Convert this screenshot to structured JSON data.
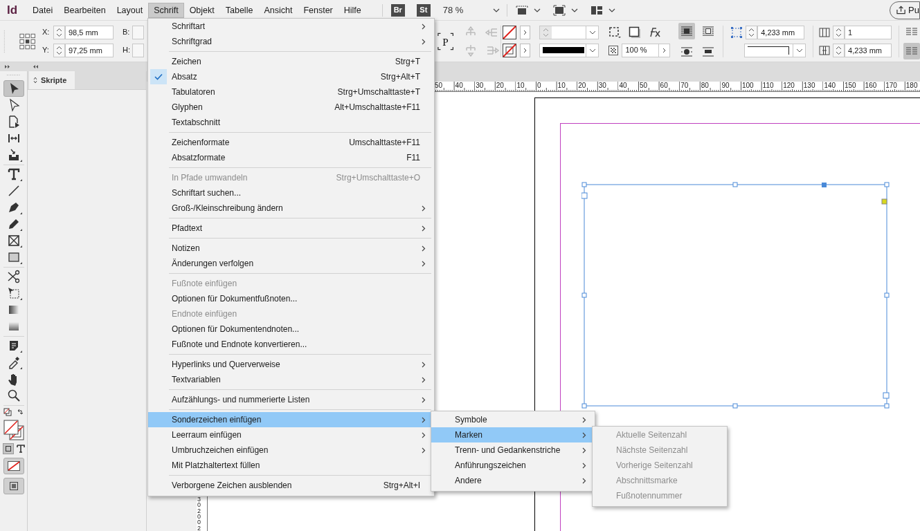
{
  "app_logo": "Id",
  "menu_bar": [
    {
      "label": "Datei",
      "selected": false
    },
    {
      "label": "Bearbeiten",
      "selected": false
    },
    {
      "label": "Layout",
      "selected": false
    },
    {
      "label": "Schrift",
      "selected": true
    },
    {
      "label": "Objekt",
      "selected": false
    },
    {
      "label": "Tabelle",
      "selected": false
    },
    {
      "label": "Ansicht",
      "selected": false
    },
    {
      "label": "Fenster",
      "selected": false
    },
    {
      "label": "Hilfe",
      "selected": false
    }
  ],
  "app_bar": {
    "badges": [
      "Br",
      "St"
    ],
    "zoom": "78 %",
    "share_button": "Pu"
  },
  "control_bar": {
    "x_label": "X:",
    "x_value": "98,5 mm",
    "y_label": "Y:",
    "y_value": "97,25 mm",
    "w_label": "B:",
    "h_label": "H:",
    "paragraph_glyph": "P",
    "opacity": "100 %",
    "frame_inset": "4,233 mm",
    "columns": "1",
    "gutter": "4,233 mm"
  },
  "panel": {
    "tab": "Skripte"
  },
  "tools": [
    {
      "kind": "selection",
      "selected": true,
      "flyout": false
    },
    {
      "kind": "direct",
      "selected": false,
      "flyout": false
    },
    {
      "kind": "page",
      "selected": false,
      "flyout": false
    },
    {
      "kind": "gap",
      "selected": false,
      "flyout": false
    },
    {
      "kind": "collector",
      "selected": false,
      "flyout": true
    },
    {
      "kind": "separator"
    },
    {
      "kind": "type",
      "selected": false,
      "flyout": true
    },
    {
      "kind": "line",
      "selected": false,
      "flyout": false
    },
    {
      "kind": "pen",
      "selected": false,
      "flyout": true
    },
    {
      "kind": "pencil",
      "selected": false,
      "flyout": true
    },
    {
      "kind": "frame",
      "selected": false,
      "flyout": true
    },
    {
      "kind": "rectangle",
      "selected": false,
      "flyout": true
    },
    {
      "kind": "separator"
    },
    {
      "kind": "scissors",
      "selected": false,
      "flyout": false
    },
    {
      "kind": "transform",
      "selected": false,
      "flyout": true
    },
    {
      "kind": "gradient",
      "selected": false,
      "flyout": false
    },
    {
      "kind": "feather",
      "selected": false,
      "flyout": false
    },
    {
      "kind": "separator"
    },
    {
      "kind": "note",
      "selected": false,
      "flyout": true
    },
    {
      "kind": "eyedropper",
      "selected": false,
      "flyout": true
    },
    {
      "kind": "hand",
      "selected": false,
      "flyout": false
    },
    {
      "kind": "zoom",
      "selected": false,
      "flyout": false
    },
    {
      "kind": "separator"
    }
  ],
  "ruler": {
    "horizontal": [
      "50",
      "40",
      "30",
      "20",
      "10",
      "0",
      "10",
      "20",
      "30",
      "40",
      "50",
      "60",
      "70",
      "80",
      "90",
      "100",
      "110",
      "120",
      "130",
      "140",
      "150",
      "160",
      "170",
      "180"
    ],
    "vertical": [
      "30",
      "200",
      "2"
    ]
  },
  "menu": {
    "items": [
      {
        "kind": "item",
        "label": "Schriftart",
        "submenu": true,
        "checked": false,
        "disabled": false,
        "selected": false
      },
      {
        "kind": "item",
        "label": "Schriftgrad",
        "submenu": true,
        "checked": false,
        "disabled": false,
        "selected": false
      },
      {
        "kind": "separator"
      },
      {
        "kind": "item",
        "label": "Zeichen",
        "shortcut": "Strg+T",
        "submenu": false,
        "checked": false,
        "disabled": false,
        "selected": false
      },
      {
        "kind": "item",
        "label": "Absatz",
        "shortcut": "Strg+Alt+T",
        "submenu": false,
        "checked": true,
        "disabled": false,
        "selected": false
      },
      {
        "kind": "item",
        "label": "Tabulatoren",
        "shortcut": "Strg+Umschalttaste+T",
        "submenu": false,
        "checked": false,
        "disabled": false,
        "selected": false
      },
      {
        "kind": "item",
        "label": "Glyphen",
        "shortcut": "Alt+Umschalttaste+F11",
        "submenu": false,
        "checked": false,
        "disabled": false,
        "selected": false
      },
      {
        "kind": "item",
        "label": "Textabschnitt",
        "submenu": false,
        "checked": false,
        "disabled": false,
        "selected": false
      },
      {
        "kind": "separator"
      },
      {
        "kind": "item",
        "label": "Zeichenformate",
        "shortcut": "Umschalttaste+F11",
        "submenu": false,
        "checked": false,
        "disabled": false,
        "selected": false
      },
      {
        "kind": "item",
        "label": "Absatzformate",
        "shortcut": "F11",
        "submenu": false,
        "checked": false,
        "disabled": false,
        "selected": false
      },
      {
        "kind": "separator"
      },
      {
        "kind": "item",
        "label": "In Pfade umwandeln",
        "shortcut": "Strg+Umschalttaste+O",
        "submenu": false,
        "checked": false,
        "disabled": true,
        "selected": false
      },
      {
        "kind": "item",
        "label": "Schriftart suchen...",
        "submenu": false,
        "checked": false,
        "disabled": false,
        "selected": false
      },
      {
        "kind": "item",
        "label": "Groß-/Kleinschreibung ändern",
        "submenu": true,
        "checked": false,
        "disabled": false,
        "selected": false
      },
      {
        "kind": "separator"
      },
      {
        "kind": "item",
        "label": "Pfadtext",
        "submenu": true,
        "checked": false,
        "disabled": false,
        "selected": false
      },
      {
        "kind": "separator"
      },
      {
        "kind": "item",
        "label": "Notizen",
        "submenu": true,
        "checked": false,
        "disabled": false,
        "selected": false
      },
      {
        "kind": "item",
        "label": "Änderungen verfolgen",
        "submenu": true,
        "checked": false,
        "disabled": false,
        "selected": false
      },
      {
        "kind": "separator"
      },
      {
        "kind": "item",
        "label": "Fußnote einfügen",
        "submenu": false,
        "checked": false,
        "disabled": true,
        "selected": false
      },
      {
        "kind": "item",
        "label": "Optionen für Dokumentfußnoten...",
        "submenu": false,
        "checked": false,
        "disabled": false,
        "selected": false
      },
      {
        "kind": "item",
        "label": "Endnote einfügen",
        "submenu": false,
        "checked": false,
        "disabled": true,
        "selected": false
      },
      {
        "kind": "item",
        "label": "Optionen für Dokumentendnoten...",
        "submenu": false,
        "checked": false,
        "disabled": false,
        "selected": false
      },
      {
        "kind": "item",
        "label": "Fußnote und Endnote konvertieren...",
        "submenu": false,
        "checked": false,
        "disabled": false,
        "selected": false
      },
      {
        "kind": "separator"
      },
      {
        "kind": "item",
        "label": "Hyperlinks und Querverweise",
        "submenu": true,
        "checked": false,
        "disabled": false,
        "selected": false
      },
      {
        "kind": "item",
        "label": "Textvariablen",
        "submenu": true,
        "checked": false,
        "disabled": false,
        "selected": false
      },
      {
        "kind": "separator"
      },
      {
        "kind": "item",
        "label": "Aufzählungs- und nummerierte Listen",
        "submenu": true,
        "checked": false,
        "disabled": false,
        "selected": false
      },
      {
        "kind": "separator"
      },
      {
        "kind": "item",
        "label": "Sonderzeichen einfügen",
        "submenu": true,
        "checked": false,
        "disabled": false,
        "selected": true
      },
      {
        "kind": "item",
        "label": "Leerraum einfügen",
        "submenu": true,
        "checked": false,
        "disabled": false,
        "selected": false
      },
      {
        "kind": "item",
        "label": "Umbruchzeichen einfügen",
        "submenu": true,
        "checked": false,
        "disabled": false,
        "selected": false
      },
      {
        "kind": "item",
        "label": "Mit Platzhaltertext füllen",
        "submenu": false,
        "checked": false,
        "disabled": false,
        "selected": false
      },
      {
        "kind": "separator"
      },
      {
        "kind": "item",
        "label": "Verborgene Zeichen ausblenden",
        "shortcut": "Strg+Alt+I",
        "submenu": false,
        "checked": false,
        "disabled": false,
        "selected": false
      }
    ]
  },
  "submenu": {
    "items": [
      {
        "kind": "item",
        "label": "Symbole",
        "submenu": true,
        "disabled": false,
        "selected": false
      },
      {
        "kind": "item",
        "label": "Marken",
        "submenu": true,
        "disabled": false,
        "selected": true
      },
      {
        "kind": "item",
        "label": "Trenn- und Gedankenstriche",
        "submenu": true,
        "disabled": false,
        "selected": false
      },
      {
        "kind": "item",
        "label": "Anführungszeichen",
        "submenu": true,
        "disabled": false,
        "selected": false
      },
      {
        "kind": "item",
        "label": "Andere",
        "submenu": true,
        "disabled": false,
        "selected": false
      }
    ]
  },
  "submenu_2": {
    "items": [
      {
        "kind": "item",
        "label": "Aktuelle Seitenzahl",
        "submenu": false,
        "disabled": true,
        "selected": false
      },
      {
        "kind": "item",
        "label": "Nächste Seitenzahl",
        "submenu": false,
        "disabled": true,
        "selected": false
      },
      {
        "kind": "item",
        "label": "Vorherige Seitenzahl",
        "submenu": false,
        "disabled": true,
        "selected": false
      },
      {
        "kind": "item",
        "label": "Abschnittsmarke",
        "submenu": false,
        "disabled": true,
        "selected": false
      },
      {
        "kind": "item",
        "label": "Fußnotennummer",
        "submenu": false,
        "disabled": true,
        "selected": false
      }
    ]
  }
}
